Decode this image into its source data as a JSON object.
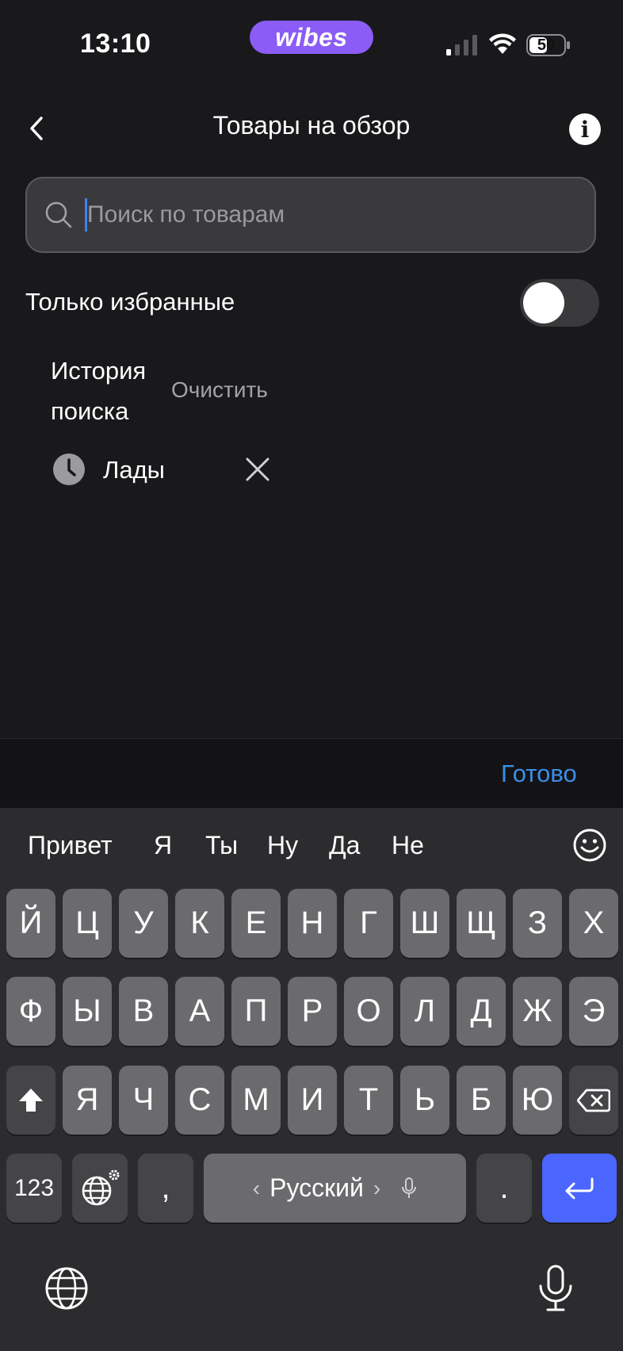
{
  "status_bar": {
    "time": "13:10",
    "brand": "wibes",
    "battery": "50"
  },
  "header": {
    "title": "Товары на обзор",
    "back_icon": "chevron-left-icon",
    "info_icon": "info-icon"
  },
  "search": {
    "placeholder": "Поиск по товарам",
    "value": ""
  },
  "favorites": {
    "label": "Только избранные",
    "enabled": false
  },
  "history": {
    "title": "История поиска",
    "clear_label": "Очистить",
    "items": [
      {
        "text": "Лады"
      }
    ]
  },
  "done_label": "Готово",
  "keyboard": {
    "suggestions": [
      "Привет",
      "Я",
      "Ты",
      "Ну",
      "Да",
      "Не"
    ],
    "row1": [
      "Й",
      "Ц",
      "У",
      "К",
      "Е",
      "Н",
      "Г",
      "Ш",
      "Щ",
      "З",
      "Х"
    ],
    "row2": [
      "Ф",
      "Ы",
      "В",
      "А",
      "П",
      "Р",
      "О",
      "Л",
      "Д",
      "Ж",
      "Э"
    ],
    "row3": [
      "Я",
      "Ч",
      "С",
      "М",
      "И",
      "Т",
      "Ь",
      "Б",
      "Ю"
    ],
    "numbers_label": "123",
    "comma_label": ",",
    "period_label": ".",
    "space_label": "Русский",
    "space_left": "‹",
    "space_right": "›",
    "accent_color": "#4a66ff"
  },
  "colors": {
    "background": "#19191c",
    "brand": "#8b5cf6",
    "link": "#3b8fe8",
    "caret": "#3b82f6"
  }
}
